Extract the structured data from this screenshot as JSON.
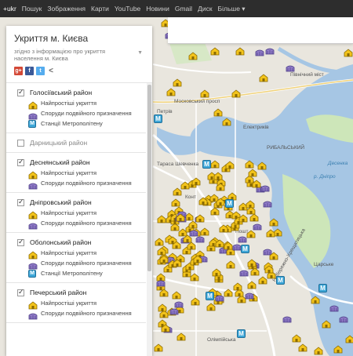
{
  "google_bar": {
    "items": [
      "+ukr",
      "Пошук",
      "Зображення",
      "Карти",
      "YouTube",
      "Новини",
      "Gmail",
      "Диск",
      "Більше ▾"
    ]
  },
  "colors": {
    "shelter": "#f2c31b",
    "dual_use": "#8f7ac6",
    "metro": "#3ea7d8",
    "river": "#a6c6e4"
  },
  "panel": {
    "title": "Укриття м. Києва",
    "subtitle": "згідно з інформацією про укриття населення м. Києва",
    "share_icons": [
      "google-plus-icon",
      "facebook-icon",
      "twitter-icon",
      "share-icon"
    ],
    "districts": [
      {
        "name": "Голосіївський район",
        "checked": true,
        "layers": [
          "Найпростіші укриття",
          "Споруди подвійного призначення",
          "Станції Метрополітену"
        ]
      },
      {
        "name": "Дарницький район",
        "checked": false,
        "layers": []
      },
      {
        "name": "Деснянський район",
        "checked": true,
        "layers": [
          "Найпростіші укриття",
          "Споруди подвійного призначення"
        ]
      },
      {
        "name": "Дніпровський район",
        "checked": true,
        "layers": [
          "Найпростіші укриття",
          "Споруди подвійного призначення"
        ]
      },
      {
        "name": "Оболонський район",
        "checked": true,
        "layers": [
          "Найпростіші укриття",
          "Споруди подвійного призначення",
          "Станції Метрополітену"
        ]
      },
      {
        "name": "Печерський район",
        "checked": true,
        "layers": [
          "Найпростіші укриття",
          "Споруди подвійного призначення"
        ]
      }
    ]
  },
  "map": {
    "labels": {
      "moskovskyi_prosp": "Московський просп",
      "pivnichnyi_mist": "Північний міст",
      "petrivka": "Петрів",
      "elektrykiv": "Електриків",
      "rybalskyi": "РИБАЛЬСЬКИЙ",
      "taras_shevchenko": "Тараса Шевченка",
      "kontraktova": "Конт",
      "poshtova": "Пошт",
      "olimpiiska": "Олімпійська",
      "dnipro_river": "р. Дніпро",
      "desenka": "Десенка",
      "tsarskyi": "Царське",
      "naberezhno": "Набережно-Хрещатицька"
    },
    "metro_letter": "M"
  }
}
